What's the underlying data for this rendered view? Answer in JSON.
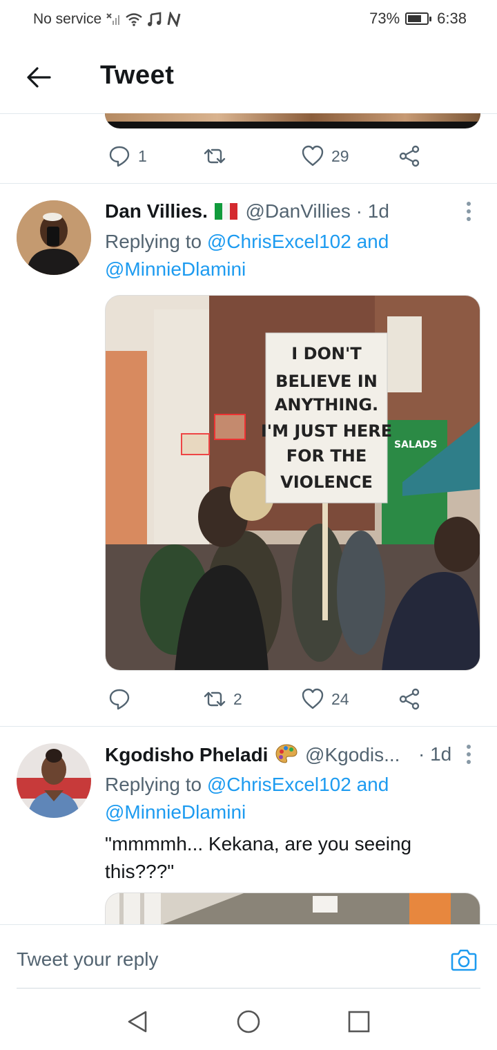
{
  "status_bar": {
    "carrier": "No service",
    "battery": "73%",
    "battery_level": 0.73,
    "time": "6:38"
  },
  "header": {
    "title": "Tweet"
  },
  "prev_tweet": {
    "reply_count": "1",
    "retweet_count": "",
    "like_count": "29"
  },
  "tweets": [
    {
      "name": "Dan Villies.",
      "flag": "🇮🇹",
      "handle": "@DanVillies",
      "time": "· 1d",
      "reply_prefix": "Replying to",
      "mention1": "@ChrisExcel102",
      "and": "and",
      "mention2": "@MinnieDlamini",
      "image_sign": [
        "I DON'T",
        "BELIEVE IN",
        "ANYTHING.",
        "I'M JUST HERE",
        "FOR THE",
        "VIOLENCE"
      ],
      "image_storefront": "SALADS",
      "reply_count": "",
      "retweet_count": "2",
      "like_count": "24"
    },
    {
      "name": "Kgodisho Pheladi",
      "emoji": "🎨",
      "handle": "@Kgodis...",
      "time": "· 1d",
      "reply_prefix": "Replying to",
      "mention1": "@ChrisExcel102",
      "and": "and",
      "mention2": "@MinnieDlamini",
      "text": "\"mmmmh... Kekana, are you seeing this???\""
    }
  ],
  "composer": {
    "placeholder": "Tweet your reply"
  },
  "colors": {
    "accent": "#1d9bf0",
    "secondary_text": "#536471",
    "divider": "#e1e8ed"
  }
}
